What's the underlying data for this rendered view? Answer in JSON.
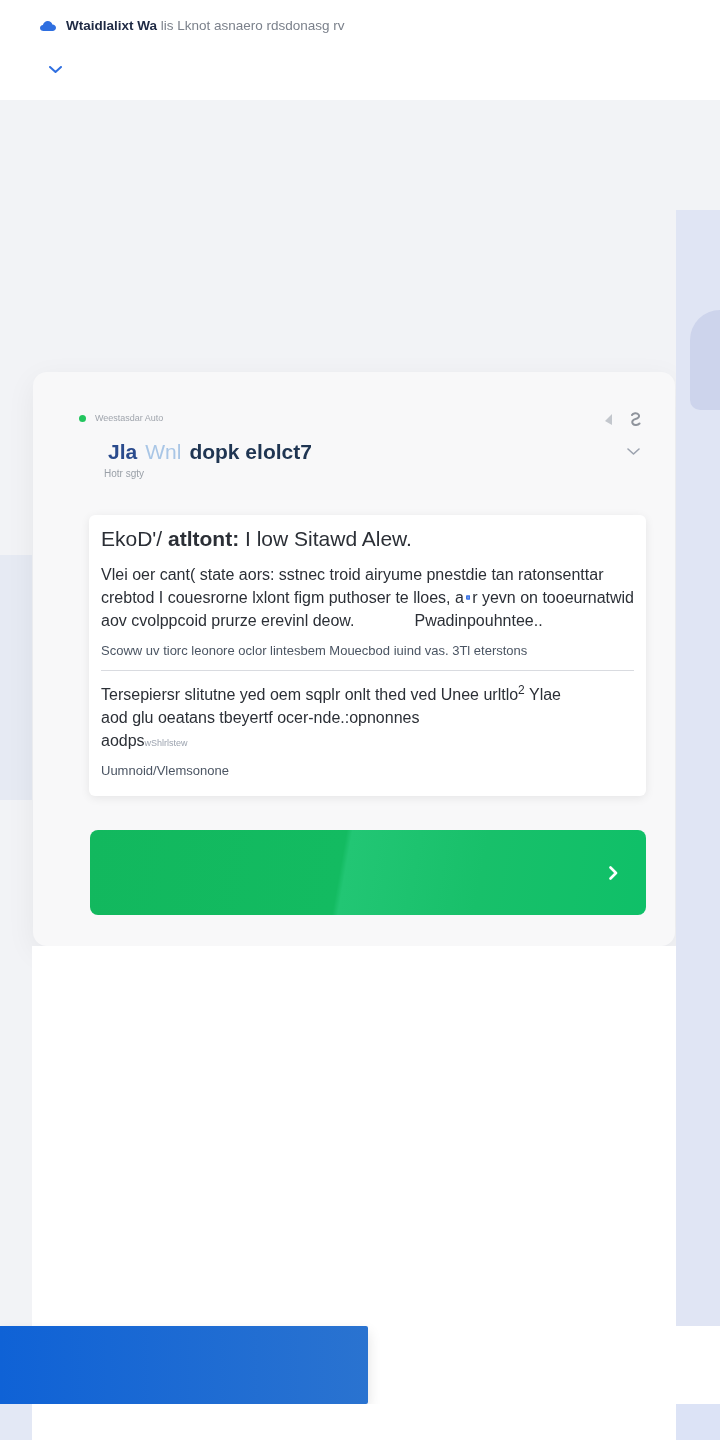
{
  "header": {
    "title": "**Wtaidlalixt Wa** lis Lknot asnaero rdsdonasg rv"
  },
  "panel": {
    "status": {
      "label": "Weestasdar Auto",
      "color": "#22c55e"
    },
    "title": [
      {
        "kind": "strong",
        "text": "Jla"
      },
      {
        "kind": "faded",
        "text": "Wnl"
      },
      {
        "kind": "plain",
        "text": "dopk elolct7"
      }
    ],
    "subtitle": "Hotr sgty"
  },
  "article": {
    "heading": "EkoD'/ **atltont:** I low Sitawd Alew.",
    "blocks": [
      {
        "kind": "paragraph",
        "lines": [
          {
            "parts": [
              {
                "kind": "text",
                "text": "Vlei oer cant( state aors: sstnec troid airyume pnestdie tan ratonsenttar"
              }
            ]
          },
          {
            "parts": [
              {
                "kind": "text",
                "text": "crebtod I couesrorne lxlont figm puthoser te lloes, a"
              },
              {
                "kind": "icon"
              },
              {
                "kind": "text",
                "text": "r yevn on tooeurnatwid"
              }
            ]
          },
          {
            "parts": [
              {
                "kind": "text",
                "text": "aov cvolppcoid prurze erevinl deow."
              },
              {
                "kind": "text",
                "text": "Pwadinpouhntee.."
              }
            ]
          }
        ]
      },
      {
        "kind": "caption",
        "text": "Scoww uv tiorc leonore oclor lintesbem Mouecbod iuind vas. 3Tl eterstons"
      },
      {
        "kind": "divider"
      },
      {
        "kind": "paragraph",
        "lines": [
          {
            "parts": [
              {
                "kind": "text",
                "text": "Tersepiersr slitutne yed oem sqplr onlt thed ved Unee urltlo$^{2}$ Ylae"
              }
            ]
          },
          {
            "parts": [
              {
                "kind": "text",
                "text": "aod glu oeatans tbeyertf ocer-nde.:opnonnes"
              }
            ]
          },
          {
            "parts": [
              {
                "kind": "text",
                "text": "aodps"
              },
              {
                "kind": "note",
                "text": "wShlrlstew"
              }
            ]
          }
        ]
      },
      {
        "kind": "caption",
        "text": "Uumnoid/Vlemsonone"
      }
    ]
  }
}
